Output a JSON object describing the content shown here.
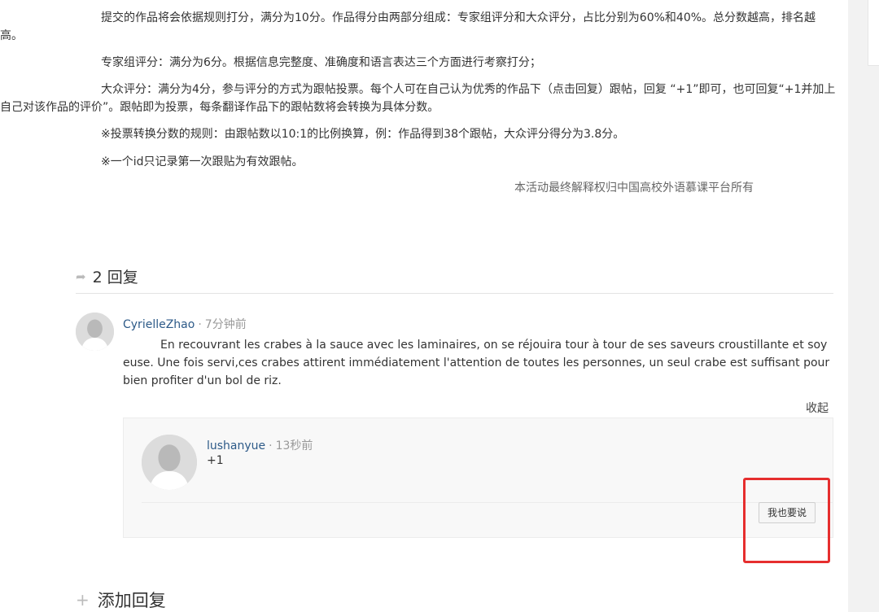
{
  "rules": {
    "p1": "提交的作品将会依据规则打分，满分为10分。作品得分由两部分组成：专家组评分和大众评分，占比分别为60%和40%。总分数越高，排名越高。",
    "p2": "专家组评分：满分为6分。根据信息完整度、准确度和语言表达三个方面进行考察打分；",
    "p3": "大众评分：满分为4分，参与评分的方式为跟帖投票。每个人可在自己认为优秀的作品下（点击回复）跟帖，回复 “+1”即可，也可回复“+1并加上自己对该作品的评价”。跟帖即为投票，每条翻译作品下的跟帖数将会转换为具体分数。",
    "p4": "※投票转换分数的规则：由跟帖数以10:1的比例换算，例：作品得到38个跟帖，大众评分得分为3.8分。",
    "p5": "※一个id只记录第一次跟贴为有效跟帖。",
    "rights": "本活动最终解释权归中国高校外语慕课平台所有"
  },
  "replies_header": {
    "icon": "share-arrow-icon",
    "count_label": "2 回复"
  },
  "comment": {
    "username": "CyrielleZhao",
    "separator": "·",
    "time": "7分钟前",
    "text": "En recouvrant les crabes à la sauce avec les laminaires, on se réjouira tour à tour de ses saveurs croustillante et soyeuse. Une fois servi,ces crabes attirent immédiatement l'attention de toutes les personnes, un seul crabe est suffisant pour bien profiter d'un bol de riz.",
    "collapse_label": "收起"
  },
  "sub_reply": {
    "username": "lushanyue",
    "separator": "·",
    "time": "13秒前",
    "text": "+1",
    "button_label": "我也要说"
  },
  "add_reply": {
    "icon": "plus-icon",
    "label": "添加回复"
  },
  "colors": {
    "username": "#2d5a88",
    "highlight": "#e62e2e"
  }
}
